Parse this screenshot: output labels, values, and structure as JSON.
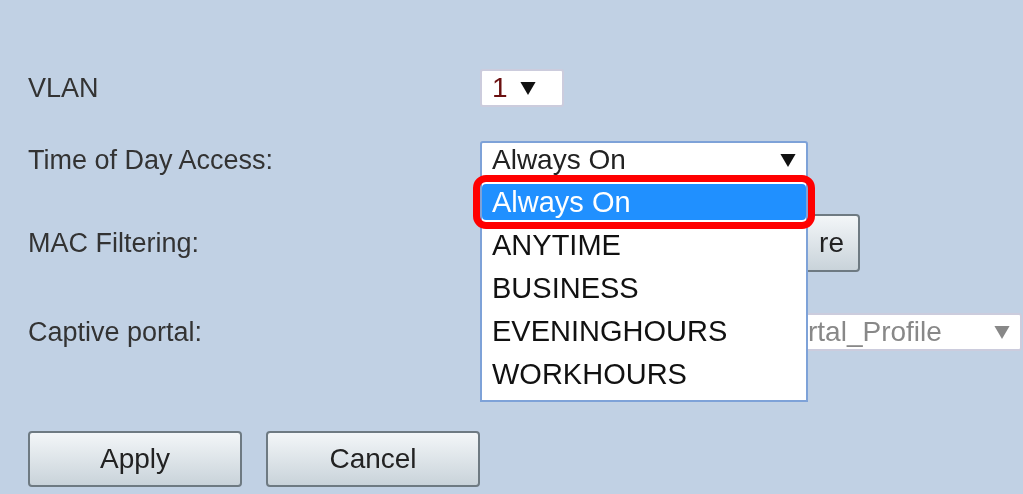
{
  "fields": [
    {
      "label": "VLAN",
      "kind": "select",
      "value": "1",
      "expanded": false,
      "disabled": false
    },
    {
      "label": "Time of Day Access:",
      "kind": "select",
      "value": "Always On",
      "expanded": true,
      "disabled": false,
      "options": [
        {
          "label": "Always On",
          "selected": true
        },
        {
          "label": "ANYTIME",
          "selected": false
        },
        {
          "label": "BUSINESS",
          "selected": false
        },
        {
          "label": "EVENINGHOURS",
          "selected": false
        },
        {
          "label": "WORKHOURS",
          "selected": false
        }
      ]
    },
    {
      "label": "MAC Filtering:",
      "kind": "button",
      "value": "re"
    },
    {
      "label": "Captive portal:",
      "kind": "select",
      "value": "rtal_Profile",
      "expanded": false,
      "disabled": true
    }
  ],
  "buttons": [
    "Apply",
    "Cancel"
  ]
}
